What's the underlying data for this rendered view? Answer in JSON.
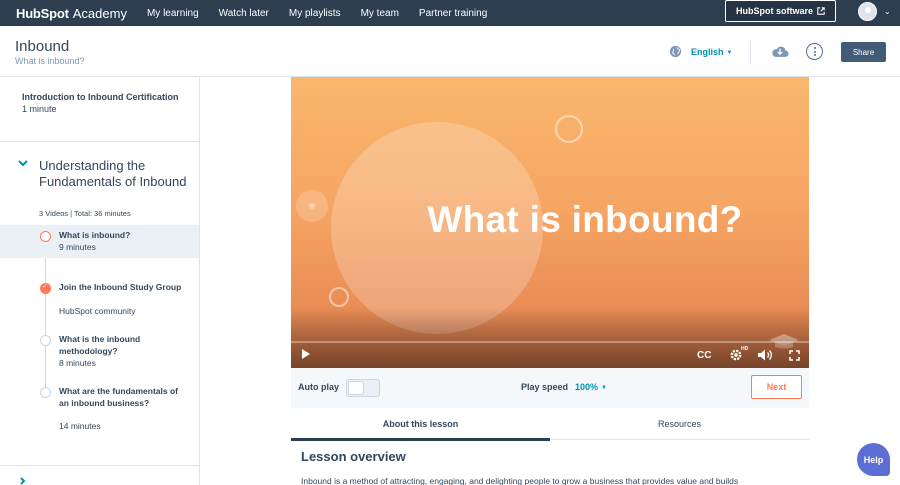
{
  "topnav": {
    "brand_hub": "HubSpot",
    "brand_academy": "Academy",
    "links": [
      "My learning",
      "Watch later",
      "My playlists",
      "My team",
      "Partner training"
    ],
    "software_button": "HubSpot software",
    "bg_color": "#2d3e50"
  },
  "header": {
    "title": "Inbound",
    "subtitle": "What is inbound?",
    "language": "English",
    "share_label": "Share"
  },
  "sidebar": {
    "intro": {
      "title": "Introduction to Inbound Certification",
      "duration": "1 minute"
    },
    "section": {
      "title": "Understanding the Fundamentals of Inbound",
      "meta": "3 Videos | Total: 36 minutes"
    },
    "lessons": [
      {
        "title": "What is inbound?",
        "duration": "9 minutes",
        "state": "active"
      },
      {
        "title": "Join the Inbound Study Group",
        "duration": "HubSpot community",
        "state": "done"
      },
      {
        "title": "What is the inbound methodology?",
        "duration": "8 minutes",
        "state": "todo"
      },
      {
        "title": "What are the fundamentals of an inbound business?",
        "duration": "14 minutes",
        "state": "todo"
      }
    ]
  },
  "video": {
    "headline": "What is inbound?",
    "cc_label": "CC",
    "hd_label": "HD",
    "progress": 0.0
  },
  "controls": {
    "autoplay_label": "Auto play",
    "autoplay_on": false,
    "speed_label": "Play speed",
    "speed_value": "100%",
    "next_label": "Next"
  },
  "tabs": [
    {
      "label": "About this lesson",
      "active": true
    },
    {
      "label": "Resources",
      "active": false
    }
  ],
  "lesson": {
    "overview_title": "Lesson overview",
    "overview_text": "Inbound is a method of attracting, engaging, and delighting people to grow a business that provides value and builds"
  },
  "help_label": "Help",
  "colors": {
    "accent": "#ff7a59",
    "link": "#0091ae",
    "help": "#5c6ed4"
  }
}
